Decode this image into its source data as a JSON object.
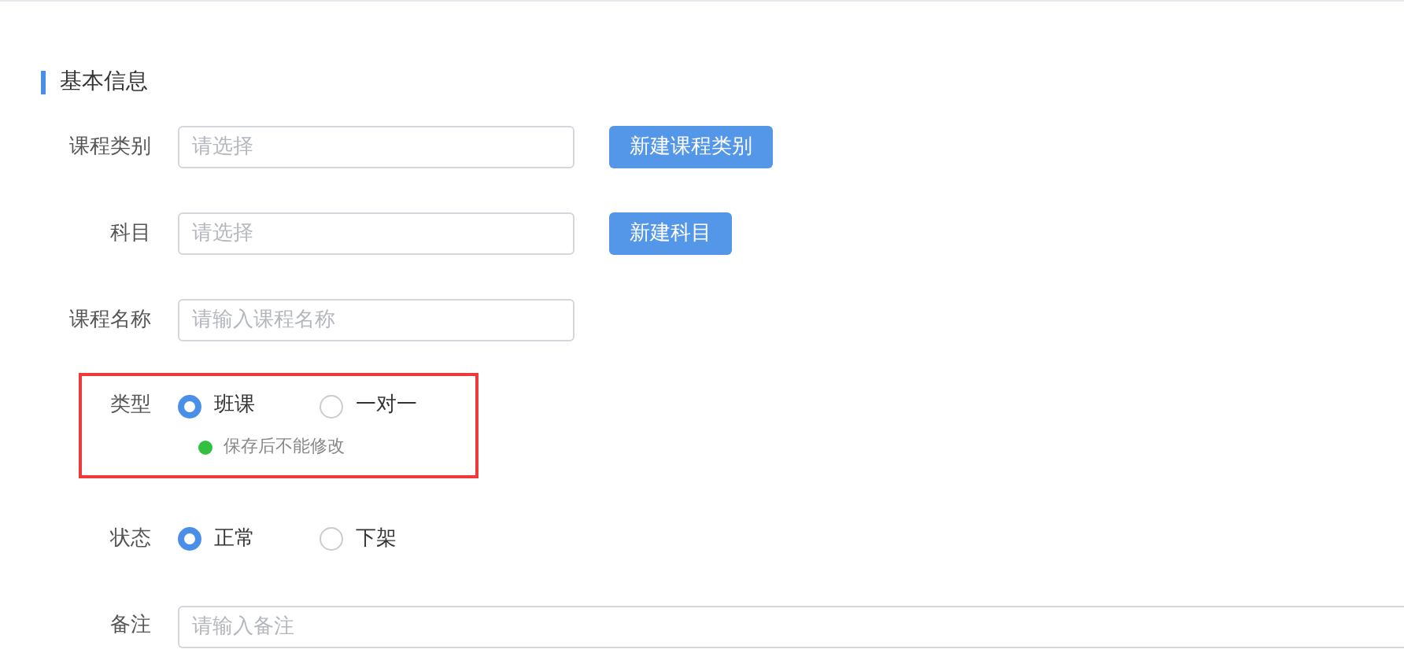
{
  "section": {
    "title": "基本信息"
  },
  "fields": [
    {
      "kind": "select",
      "label": "课程类别",
      "placeholder": "请选择",
      "button": "新建课程类别"
    },
    {
      "kind": "select",
      "label": "科目",
      "placeholder": "请选择",
      "button": "新建科目"
    },
    {
      "kind": "text",
      "label": "课程名称",
      "placeholder": "请输入课程名称"
    },
    {
      "kind": "radio",
      "label": "类型",
      "highlighted": true,
      "options": [
        {
          "label": "班课",
          "selected": true
        },
        {
          "label": "一对一",
          "selected": false
        }
      ],
      "hint": {
        "text": "保存后不能修改",
        "color": "#33c03f"
      }
    },
    {
      "kind": "radio",
      "label": "状态",
      "highlighted": false,
      "options": [
        {
          "label": "正常",
          "selected": true
        },
        {
          "label": "下架",
          "selected": false
        }
      ]
    },
    {
      "kind": "wide",
      "label": "备注",
      "placeholder": "请输入备注"
    }
  ]
}
